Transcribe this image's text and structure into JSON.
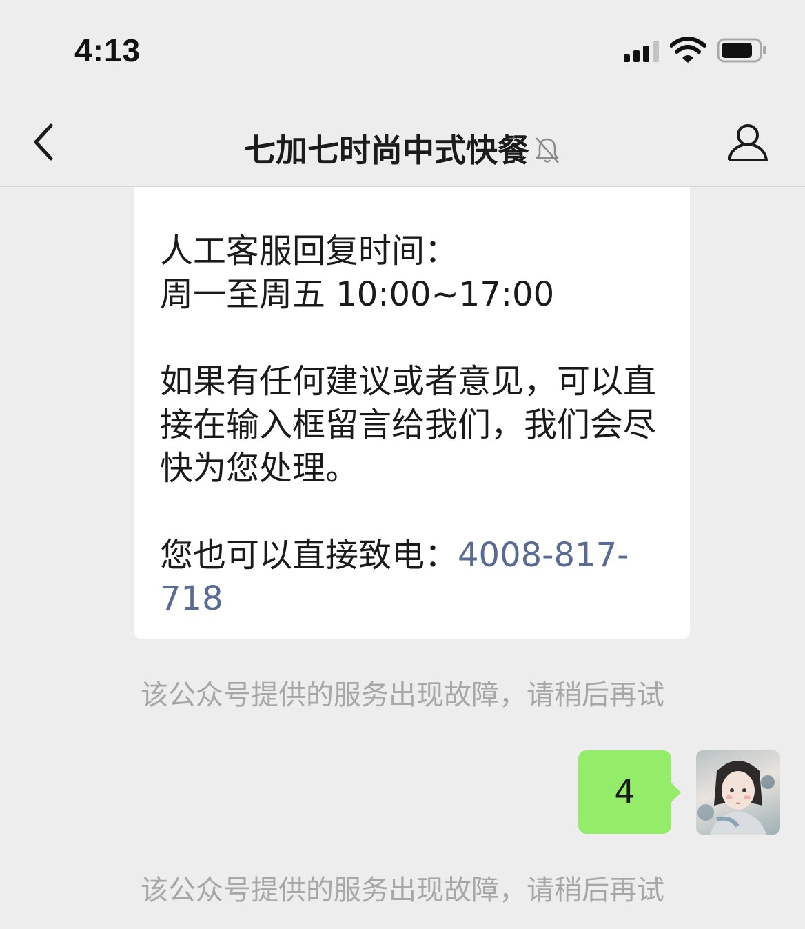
{
  "status_bar": {
    "time": "4:13"
  },
  "nav": {
    "title": "七加七时尚中式快餐"
  },
  "chat": {
    "card": {
      "line1": "人工客服回复时间：",
      "line2": "周一至周五 10:00~17:00",
      "para2": "如果有任何建议或者意见，可以直接在输入框留言给我们，我们会尽快为您处理。",
      "call_prefix": "您也可以直接致电：",
      "phone": "4008-817-718"
    },
    "system_notice_1": "该公众号提供的服务出现故障，请稍后再试",
    "user_message": "4",
    "system_notice_2": "该公众号提供的服务出现故障，请稍后再试"
  },
  "colors": {
    "background": "#ededed",
    "user_bubble": "#95ec69",
    "link": "#576b95",
    "system_text": "#a7a7a7"
  },
  "icons": {
    "back": "chevron-left-icon",
    "mute": "bell-off-icon",
    "profile": "person-icon",
    "signal": "cellular-signal-icon",
    "wifi": "wifi-icon",
    "battery": "battery-icon"
  }
}
